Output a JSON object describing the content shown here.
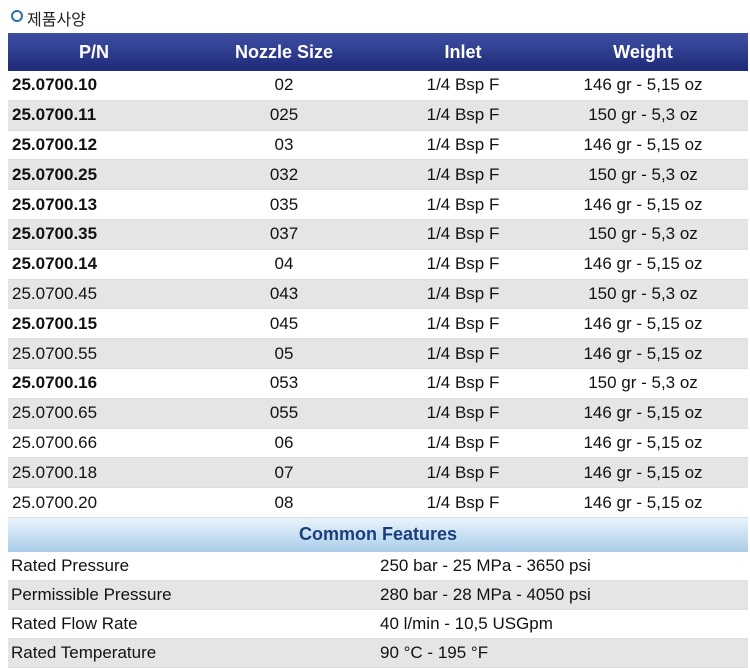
{
  "page": {
    "title": "제품사양"
  },
  "spec_table": {
    "headers": {
      "pn": "P/N",
      "nozzle": "Nozzle Size",
      "inlet": "Inlet",
      "weight": "Weight"
    },
    "rows": [
      {
        "pn": "25.0700.10",
        "bold": true,
        "nozzle": "02",
        "inlet": "1/4 Bsp F",
        "weight": "146 gr - 5,15 oz"
      },
      {
        "pn": "25.0700.11",
        "bold": true,
        "nozzle": "025",
        "inlet": "1/4 Bsp F",
        "weight": "150 gr - 5,3 oz"
      },
      {
        "pn": "25.0700.12",
        "bold": true,
        "nozzle": "03",
        "inlet": "1/4 Bsp F",
        "weight": "146 gr - 5,15 oz"
      },
      {
        "pn": "25.0700.25",
        "bold": true,
        "nozzle": "032",
        "inlet": "1/4 Bsp F",
        "weight": "150 gr - 5,3 oz"
      },
      {
        "pn": "25.0700.13",
        "bold": true,
        "nozzle": "035",
        "inlet": "1/4 Bsp F",
        "weight": "146 gr - 5,15 oz"
      },
      {
        "pn": "25.0700.35",
        "bold": true,
        "nozzle": "037",
        "inlet": "1/4 Bsp F",
        "weight": "150 gr - 5,3 oz"
      },
      {
        "pn": "25.0700.14",
        "bold": true,
        "nozzle": "04",
        "inlet": "1/4 Bsp F",
        "weight": "146 gr - 5,15 oz"
      },
      {
        "pn": "25.0700.45",
        "bold": false,
        "nozzle": "043",
        "inlet": "1/4 Bsp F",
        "weight": "150 gr - 5,3 oz"
      },
      {
        "pn": "25.0700.15",
        "bold": true,
        "nozzle": "045",
        "inlet": "1/4 Bsp F",
        "weight": "146 gr - 5,15 oz"
      },
      {
        "pn": "25.0700.55",
        "bold": false,
        "nozzle": "05",
        "inlet": "1/4 Bsp F",
        "weight": "146 gr - 5,15 oz"
      },
      {
        "pn": "25.0700.16",
        "bold": true,
        "nozzle": "053",
        "inlet": "1/4 Bsp F",
        "weight": "150 gr - 5,3 oz"
      },
      {
        "pn": "25.0700.65",
        "bold": false,
        "nozzle": "055",
        "inlet": "1/4 Bsp F",
        "weight": "146 gr - 5,15 oz"
      },
      {
        "pn": "25.0700.66",
        "bold": false,
        "nozzle": "06",
        "inlet": "1/4 Bsp F",
        "weight": "146 gr - 5,15 oz"
      },
      {
        "pn": "25.0700.18",
        "bold": false,
        "nozzle": "07",
        "inlet": "1/4 Bsp F",
        "weight": "146 gr - 5,15 oz"
      },
      {
        "pn": "25.0700.20",
        "bold": false,
        "nozzle": "08",
        "inlet": "1/4 Bsp F",
        "weight": "146 gr - 5,15 oz"
      }
    ]
  },
  "features": {
    "title": "Common Features",
    "rows": [
      {
        "label": "Rated Pressure",
        "value": "250 bar - 25 MPa - 3650 psi"
      },
      {
        "label": "Permissible Pressure",
        "value": "280 bar - 28 MPa - 4050 psi"
      },
      {
        "label": "Rated Flow Rate",
        "value": "40 l/min - 10,5 USGpm"
      },
      {
        "label": "Rated Temperature",
        "value": "90 °C - 195 °F"
      }
    ]
  },
  "colors": {
    "header_bg": "#2a3589",
    "band_bg": "#a9cde9",
    "row_alt": "#e5e5e5",
    "bullet": "#2f6fa8"
  }
}
